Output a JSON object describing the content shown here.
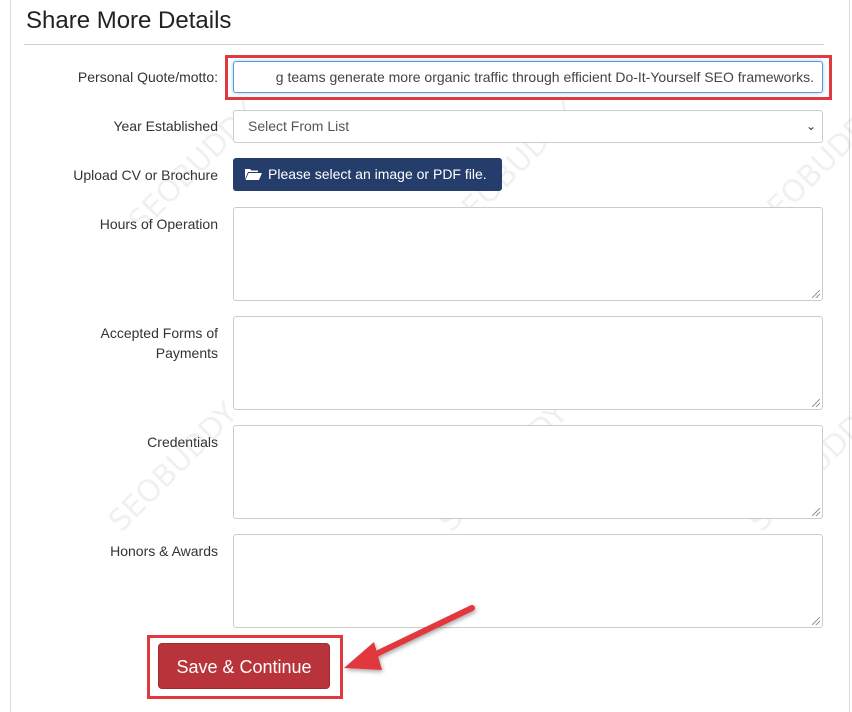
{
  "section_title": "Share More Details",
  "fields": {
    "quote_label": "Personal Quote/motto:",
    "quote_value": "g teams generate more organic traffic through efficient Do-It-Yourself SEO frameworks.",
    "year_label": "Year Established",
    "year_select": "Select From List",
    "upload_label": "Upload CV or Brochure",
    "upload_button": "Please select an image or PDF file.",
    "hours_label": "Hours of Operation",
    "payments_label": "Accepted Forms of Payments",
    "credentials_label": "Credentials",
    "honors_label": "Honors & Awards"
  },
  "save_button": "Save & Continue",
  "watermark": "SEOBUDDY",
  "colors": {
    "highlight": "#e0393e",
    "save_button": "#b8333a",
    "upload_button": "#243d6b"
  }
}
